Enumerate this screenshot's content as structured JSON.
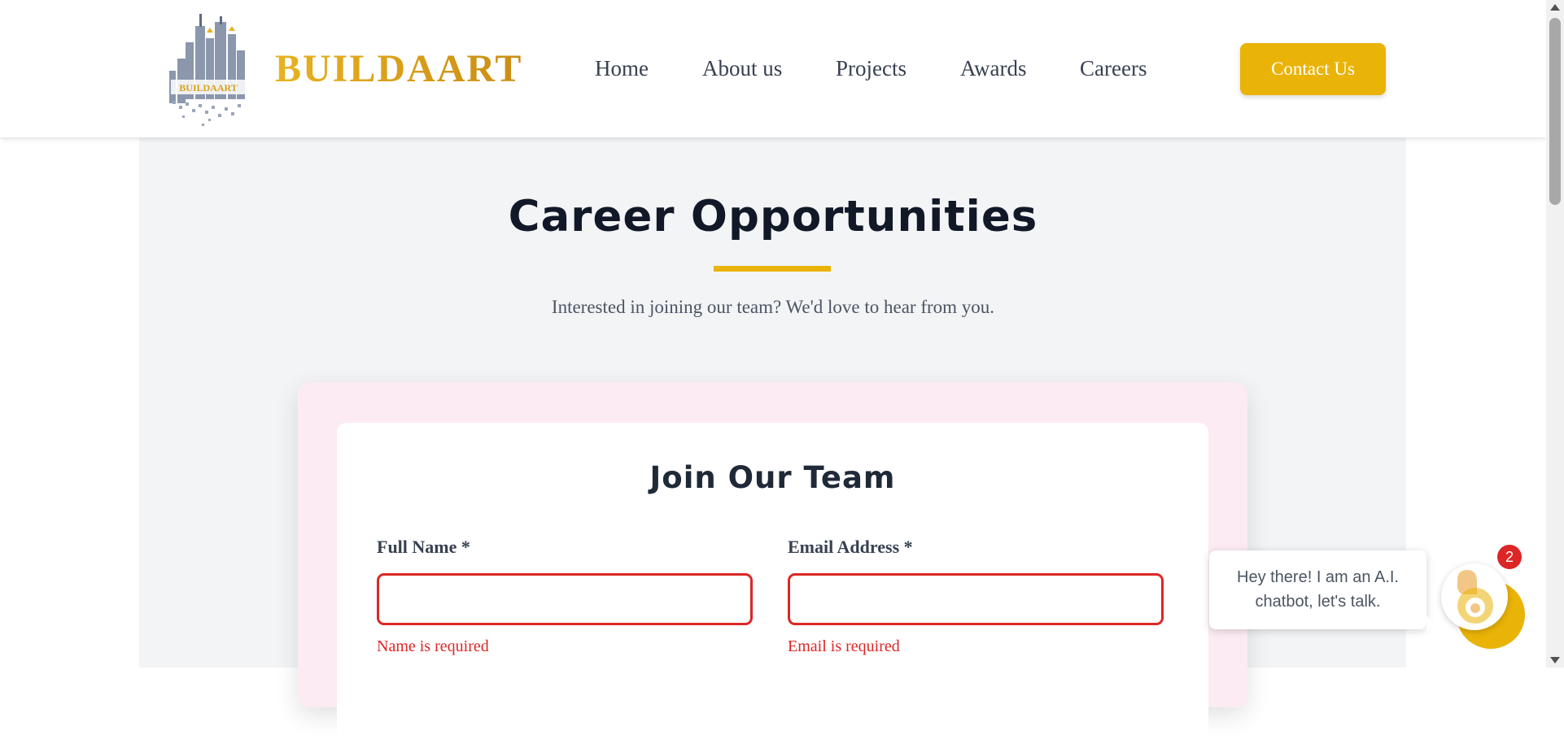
{
  "header": {
    "brand": "BUILDAART",
    "logo_text": "BUILDAART",
    "nav": [
      {
        "label": "Home"
      },
      {
        "label": "About us"
      },
      {
        "label": "Projects"
      },
      {
        "label": "Awards"
      },
      {
        "label": "Careers"
      }
    ],
    "contact_label": "Contact Us"
  },
  "main": {
    "title": "Career Opportunities",
    "subtitle": "Interested in joining our team? We'd love to hear from you."
  },
  "form": {
    "title": "Join Our Team",
    "fields": [
      {
        "label": "Full Name *",
        "value": "",
        "error": "Name is required"
      },
      {
        "label": "Email Address *",
        "value": "",
        "error": "Email is required"
      }
    ]
  },
  "chat": {
    "message": "Hey there! I am an A.I. chatbot, let's talk.",
    "badge": "2"
  },
  "colors": {
    "accent": "#eab308",
    "error": "#dc2626",
    "form_outer": "#fcebf3",
    "page_bg": "#f3f4f6"
  }
}
